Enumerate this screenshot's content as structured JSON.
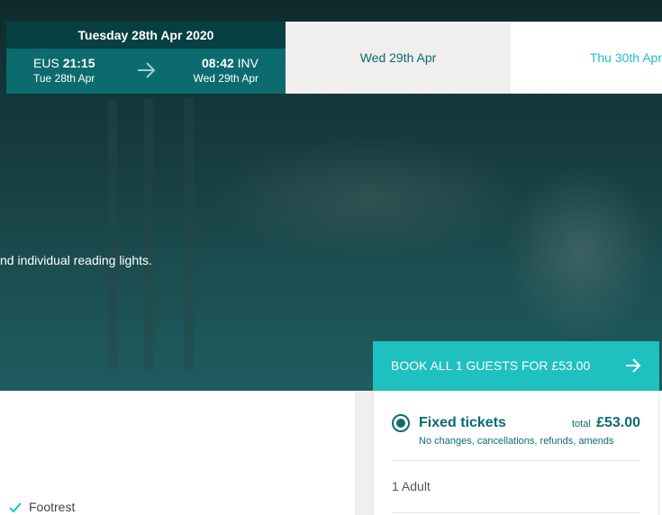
{
  "date_selector": {
    "selected": {
      "title": "Tuesday 28th Apr 2020",
      "departure": {
        "station": "EUS",
        "time": "21:15",
        "date": "Tue 28th Apr"
      },
      "arrival": {
        "station": "INV",
        "time": "08:42",
        "date": "Wed 29th Apr"
      }
    },
    "tabs": [
      {
        "label": "Wed 29th Apr"
      },
      {
        "label": "Thu 30th Apr"
      }
    ]
  },
  "hero": {
    "text": "nd individual reading lights."
  },
  "booking": {
    "button_label": "BOOK ALL 1 GUESTS FOR £53.00",
    "fare": {
      "name": "Fixed tickets",
      "description": "No changes, cancellations, refunds, amends",
      "total_label": "total",
      "total_price": "£53.00",
      "selected": true
    },
    "guests": "1 Adult"
  },
  "amenities": [
    {
      "label": "Footrest",
      "icon": "check-icon"
    }
  ],
  "colors": {
    "dark_teal": "#073f43",
    "teal": "#0c6b6f",
    "accent": "#1ec0c0",
    "tab_gray": "#f0efed"
  }
}
